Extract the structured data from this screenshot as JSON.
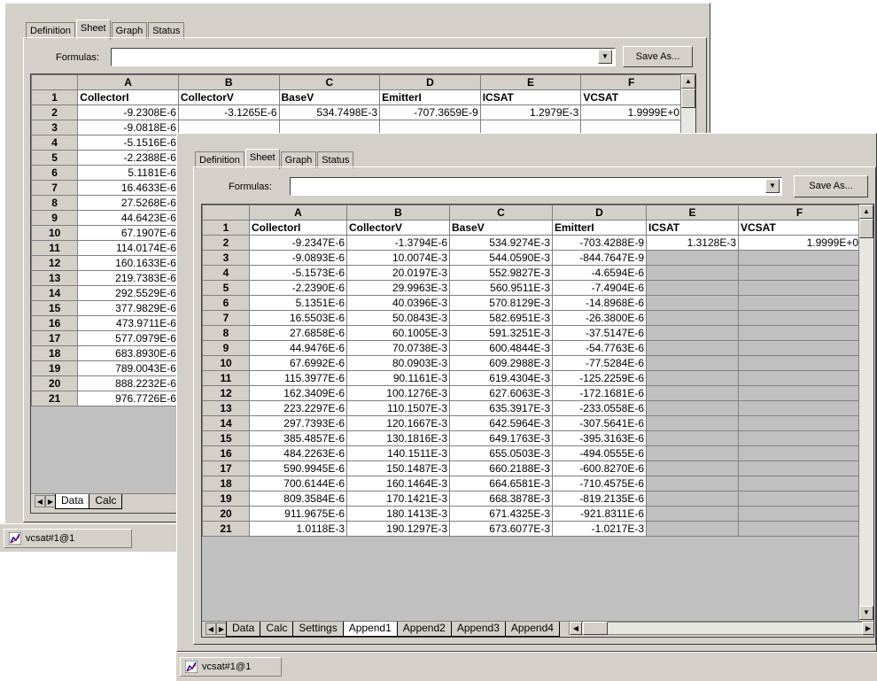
{
  "tabs": [
    "Definition",
    "Sheet",
    "Graph",
    "Status"
  ],
  "formulas_label": "Formulas:",
  "formula_value": "",
  "dropdown_glyph": "▼",
  "save_as_label": "Save As...",
  "taskbar_item": "vcsat#1@1",
  "back": {
    "columns": [
      "A",
      "B",
      "C",
      "D",
      "E",
      "F"
    ],
    "header_row": [
      "CollectorI",
      "CollectorV",
      "BaseV",
      "EmitterI",
      "ICSAT",
      "VCSAT"
    ],
    "row2_rest": [
      "-3.1265E-6",
      "534.7498E-3",
      "-707.3659E-9",
      "1.2979E-3",
      "1.9999E+0"
    ],
    "colA": [
      "-9.2308E-6",
      "-9.0818E-6",
      "-5.1516E-6",
      "-2.2388E-6",
      "5.1181E-6",
      "16.4633E-6",
      "27.5268E-6",
      "44.6423E-6",
      "67.1907E-6",
      "114.0174E-6",
      "160.1633E-6",
      "219.7383E-6",
      "292.5529E-6",
      "377.9829E-6",
      "473.9711E-6",
      "577.0979E-6",
      "683.8930E-6",
      "789.0043E-6",
      "888.2232E-6",
      "976.7726E-6"
    ],
    "sheet_tabs": [
      "Data",
      "Calc"
    ]
  },
  "front": {
    "columns": [
      "A",
      "B",
      "C",
      "D",
      "E",
      "F"
    ],
    "header_row": [
      "CollectorI",
      "CollectorV",
      "BaseV",
      "EmitterI",
      "ICSAT",
      "VCSAT"
    ],
    "rows": [
      [
        "-9.2347E-6",
        "-1.3794E-6",
        "534.9274E-3",
        "-703.4288E-9",
        "1.3128E-3",
        "1.9999E+0"
      ],
      [
        "-9.0893E-6",
        "10.0074E-3",
        "544.0590E-3",
        "-844.7647E-9",
        "",
        ""
      ],
      [
        "-5.1573E-6",
        "20.0197E-3",
        "552.9827E-3",
        "-4.6594E-6",
        "",
        ""
      ],
      [
        "-2.2390E-6",
        "29.9963E-3",
        "560.9511E-3",
        "-7.4904E-6",
        "",
        ""
      ],
      [
        "5.1351E-6",
        "40.0396E-3",
        "570.8129E-3",
        "-14.8968E-6",
        "",
        ""
      ],
      [
        "16.5503E-6",
        "50.0843E-3",
        "582.6951E-3",
        "-26.3800E-6",
        "",
        ""
      ],
      [
        "27.6858E-6",
        "60.1005E-3",
        "591.3251E-3",
        "-37.5147E-6",
        "",
        ""
      ],
      [
        "44.9476E-6",
        "70.0738E-3",
        "600.4844E-3",
        "-54.7763E-6",
        "",
        ""
      ],
      [
        "67.6992E-6",
        "80.0903E-3",
        "609.2988E-3",
        "-77.5284E-6",
        "",
        ""
      ],
      [
        "115.3977E-6",
        "90.1161E-3",
        "619.4304E-3",
        "-125.2259E-6",
        "",
        ""
      ],
      [
        "162.3409E-6",
        "100.1276E-3",
        "627.6063E-3",
        "-172.1681E-6",
        "",
        ""
      ],
      [
        "223.2297E-6",
        "110.1507E-3",
        "635.3917E-3",
        "-233.0558E-6",
        "",
        ""
      ],
      [
        "297.7393E-6",
        "120.1667E-3",
        "642.5964E-3",
        "-307.5641E-6",
        "",
        ""
      ],
      [
        "385.4857E-6",
        "130.1816E-3",
        "649.1763E-3",
        "-395.3163E-6",
        "",
        ""
      ],
      [
        "484.2263E-6",
        "140.1511E-3",
        "655.0503E-3",
        "-494.0555E-6",
        "",
        ""
      ],
      [
        "590.9945E-6",
        "150.1487E-3",
        "660.2188E-3",
        "-600.8270E-6",
        "",
        ""
      ],
      [
        "700.6144E-6",
        "160.1464E-3",
        "664.6581E-3",
        "-710.4575E-6",
        "",
        ""
      ],
      [
        "809.3584E-6",
        "170.1421E-3",
        "668.3878E-3",
        "-819.2135E-6",
        "",
        ""
      ],
      [
        "911.9675E-6",
        "180.1413E-3",
        "671.4325E-3",
        "-921.8311E-6",
        "",
        ""
      ],
      [
        "1.0118E-3",
        "190.1297E-3",
        "673.6077E-3",
        "-1.0217E-3",
        "",
        ""
      ]
    ],
    "sheet_tabs": [
      "Data",
      "Calc",
      "Settings",
      "Append1",
      "Append2",
      "Append3",
      "Append4"
    ],
    "active_sheet_tab": "Append1"
  }
}
